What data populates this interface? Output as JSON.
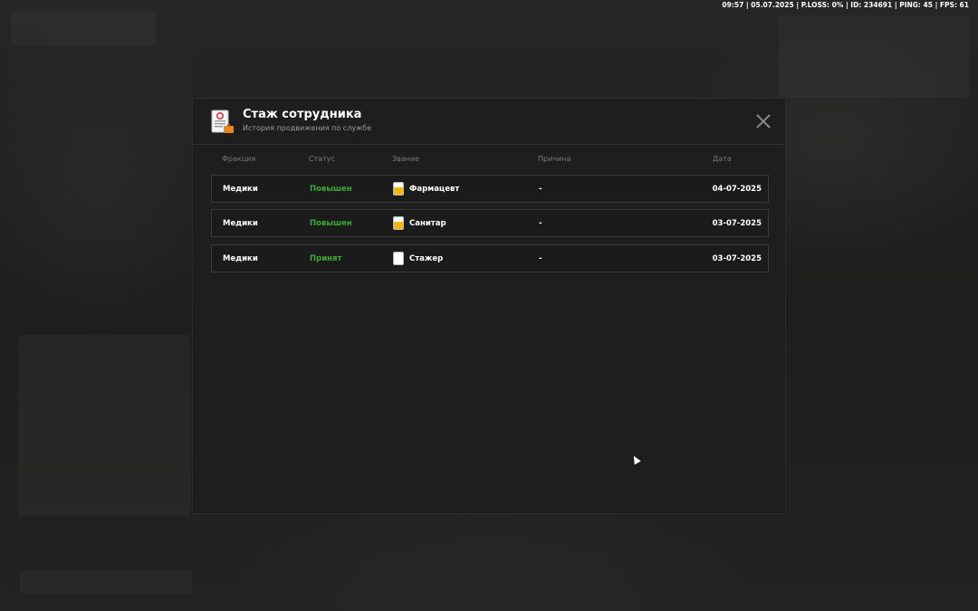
{
  "status_bar": "09:57 | 05.07.2025 | P.LOSS: 0% | ID: 234691 | PING: 45 | FPS: 61",
  "modal": {
    "title": "Стаж сотрудника",
    "subtitle": "История продвижения по службе",
    "icon": "document-icon"
  },
  "table": {
    "columns": [
      "Фракция",
      "Статус",
      "Звание",
      "Причина",
      "Дата"
    ],
    "rows": [
      {
        "faction": "Медики",
        "status": "Повышен",
        "rank": "Фармацевт",
        "rank_icon": "yellow",
        "reason": "-",
        "date": "04-07-2025"
      },
      {
        "faction": "Медики",
        "status": "Повышен",
        "rank": "Санитар",
        "rank_icon": "yellow",
        "reason": "-",
        "date": "03-07-2025"
      },
      {
        "faction": "Медики",
        "status": "Принят",
        "rank": "Стажер",
        "rank_icon": "white",
        "reason": "-",
        "date": "03-07-2025"
      }
    ]
  },
  "colors": {
    "status_green": "#3fa83a",
    "rank_yellow": "#f2b814"
  }
}
